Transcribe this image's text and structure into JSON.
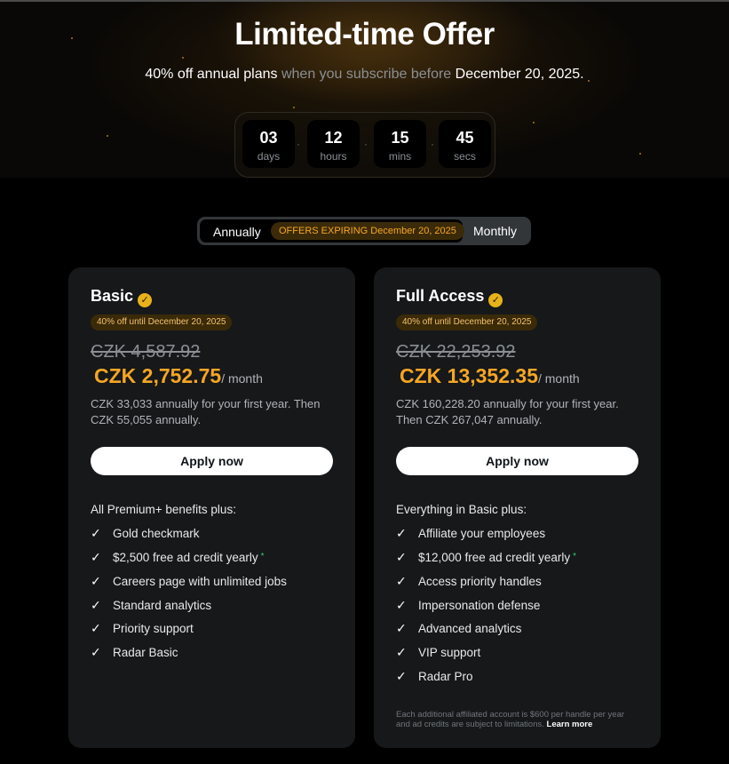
{
  "header": {
    "title": "Limited-time Offer",
    "subtitle_bold": "40% off annual plans",
    "subtitle_mid": " when you subscribe before ",
    "subtitle_date": "December 20, 2025."
  },
  "countdown": [
    {
      "value": "03",
      "label": "days"
    },
    {
      "value": "12",
      "label": "hours"
    },
    {
      "value": "15",
      "label": "mins"
    },
    {
      "value": "45",
      "label": "secs"
    }
  ],
  "billing_toggle": {
    "annually": "Annually",
    "offer_pill": "OFFERS EXPIRING December 20, 2025",
    "monthly": "Monthly",
    "selected": "Annually"
  },
  "plans": [
    {
      "name": "Basic",
      "offer_badge": "40% off until December 20, 2025",
      "old_price": "CZK 4,587.92",
      "new_price": "CZK 2,752.75",
      "per": "/ month",
      "description": "CZK 33,033 annually for your first year. Then CZK 55,055 annually.",
      "cta": "Apply now",
      "intro": "All Premium+ benefits plus:",
      "features": [
        "Gold checkmark",
        "$2,500 free ad credit yearly",
        "Careers page with unlimited jobs",
        "Standard analytics",
        "Priority support",
        "Radar Basic"
      ]
    },
    {
      "name": "Full Access",
      "offer_badge": "40% off until December 20, 2025",
      "old_price": "CZK 22,253.92",
      "new_price": "CZK 13,352.35",
      "per": "/ month",
      "description": "CZK 160,228.20 annually for your first year. Then CZK 267,047 annually.",
      "cta": "Apply now",
      "intro": "Everything in Basic plus:",
      "features": [
        "Affiliate your employees",
        "$12,000 free ad credit yearly",
        "Access priority handles",
        "Impersonation defense",
        "Advanced analytics",
        "VIP support",
        "Radar Pro"
      ],
      "footnote": "Each additional affiliated account is $600 per handle per year and ad credits are subject to limitations.",
      "learn_more": "Learn more"
    }
  ],
  "symbols": {
    "check": "✓",
    "asterisk": "*",
    "badge": "✓"
  },
  "colors": {
    "accent": "#f5a623",
    "badge_gold": "#e8b21a",
    "card_bg": "#16181a"
  }
}
